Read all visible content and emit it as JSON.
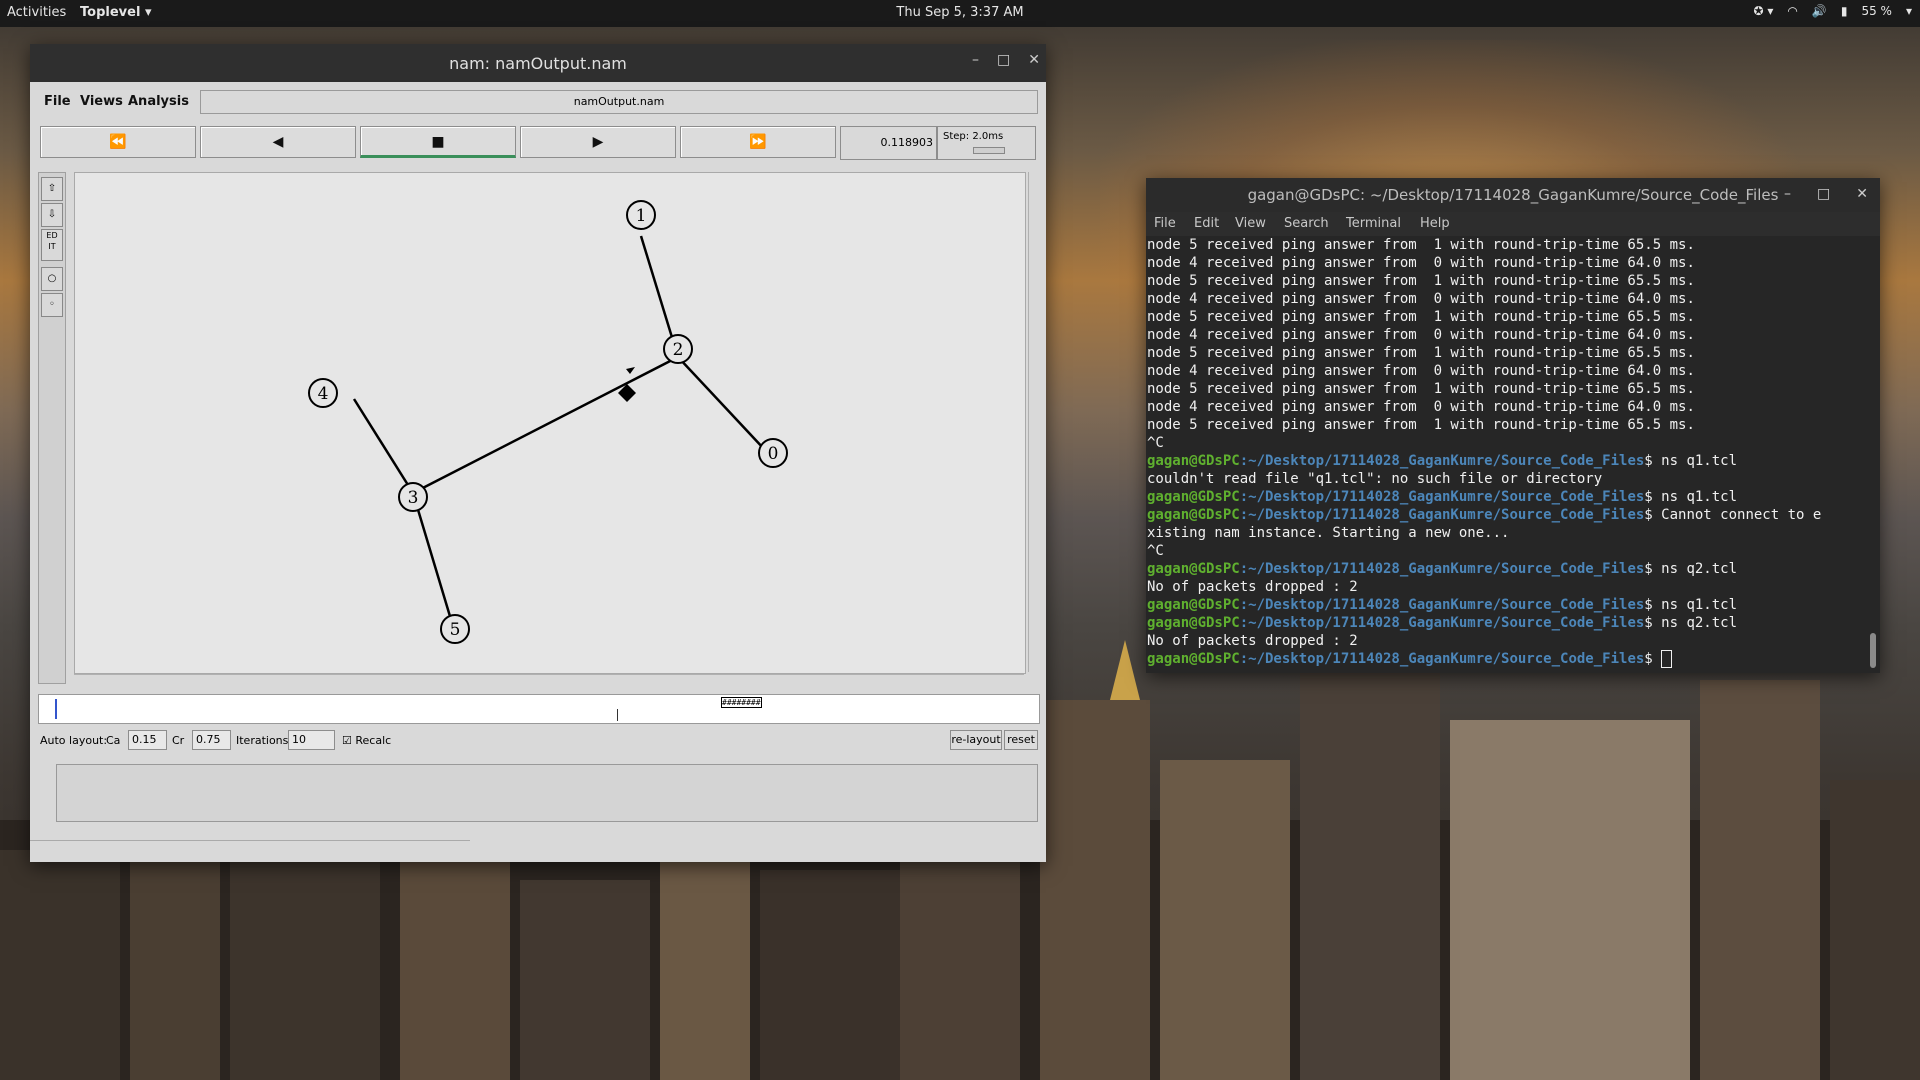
{
  "topbar": {
    "activities": "Activities",
    "app_menu": "Toplevel",
    "clock": "Thu Sep  5,  3:37 AM",
    "battery": "55 %"
  },
  "nam_window": {
    "title": "nam: namOutput.nam",
    "menu": {
      "file": "File",
      "views": "Views",
      "analysis": "Analysis"
    },
    "filename": "namOutput.nam",
    "controls": {
      "rewind_icon": "⏪",
      "back_icon": "◀",
      "stop_icon": "■",
      "play_icon": "▶",
      "ffwd_icon": "⏩"
    },
    "time": "0.118903",
    "step": "Step: 2.0ms",
    "nodes": [
      "1",
      "2",
      "4",
      "0",
      "3",
      "5"
    ],
    "edit_label": "ED IT",
    "timeline_marker": "########",
    "autolayout": {
      "label": "Auto layout:",
      "ca_label": "Ca",
      "ca_value": "0.15",
      "cr_label": "Cr",
      "cr_value": "0.75",
      "iterations_label": "Iterations",
      "iterations_value": "10",
      "recalc_label": "Recalc",
      "relayout_button": "re-layout",
      "reset_button": "reset"
    }
  },
  "terminal": {
    "title": "gagan@GDsPC: ~/Desktop/17114028_GaganKumre/Source_Code_Files",
    "menu": [
      "File",
      "Edit",
      "View",
      "Search",
      "Terminal",
      "Help"
    ],
    "prompt_user": "gagan@GDsPC",
    "prompt_path": ":~/Desktop/17114028_GaganKumre/Source_Code_Files",
    "lines": [
      "node 5 received ping answer from  1 with round-trip-time 65.5 ms.",
      "node 4 received ping answer from  0 with round-trip-time 64.0 ms.",
      "node 5 received ping answer from  1 with round-trip-time 65.5 ms.",
      "node 4 received ping answer from  0 with round-trip-time 64.0 ms.",
      "node 5 received ping answer from  1 with round-trip-time 65.5 ms.",
      "node 4 received ping answer from  0 with round-trip-time 64.0 ms.",
      "node 5 received ping answer from  1 with round-trip-time 65.5 ms.",
      "node 4 received ping answer from  0 with round-trip-time 64.0 ms.",
      "node 5 received ping answer from  1 with round-trip-time 65.5 ms.",
      "node 4 received ping answer from  0 with round-trip-time 64.0 ms.",
      "node 5 received ping answer from  1 with round-trip-time 65.5 ms.",
      "^C"
    ],
    "cmd1": "$ ns q1.tcl",
    "out1": "couldn't read file \"q1.tcl\": no such file or directory",
    "cmd2": "$ ns q1.tcl",
    "cmd3": "$ Cannot connect to e",
    "out3": "xisting nam instance. Starting a new one...",
    "out3b": "^C",
    "cmd4": "$ ns q2.tcl",
    "out4": "No of packets dropped : 2",
    "cmd5": "$ ns q1.tcl",
    "cmd6": "$ ns q2.tcl",
    "out6": "No of packets dropped : 2",
    "cmd7": "$ "
  }
}
